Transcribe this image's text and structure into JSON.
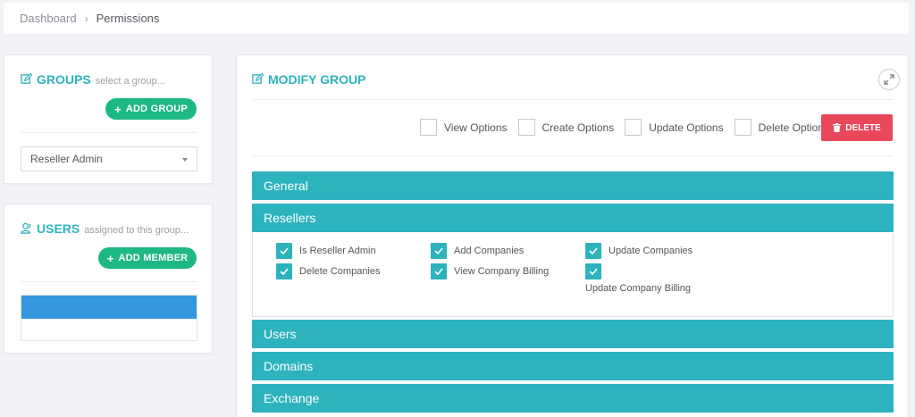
{
  "breadcrumb": {
    "home": "Dashboard",
    "separator": "›",
    "current": "Permissions"
  },
  "groups_panel": {
    "title": "GROUPS",
    "subtitle": "select a group...",
    "add_label": "ADD GROUP",
    "select_value": "Reseller Admin"
  },
  "users_panel": {
    "title": "USERS",
    "subtitle": "assigned to this group...",
    "add_label": "ADD MEMBER"
  },
  "modify_panel": {
    "title": "MODIFY GROUP",
    "options": [
      "View Options",
      "Create Options",
      "Update Options",
      "Delete Options"
    ],
    "delete_label": "DELETE",
    "sections": [
      "General",
      "Resellers",
      "Users",
      "Domains",
      "Exchange"
    ],
    "reseller_permissions": [
      "Is Reseller Admin",
      "Add Companies",
      "Update Companies",
      "Delete Companies",
      "View Company Billing",
      "Update Company Billing"
    ]
  },
  "colors": {
    "accent": "#2cb3bd",
    "green": "#1db886",
    "danger": "#e9475a",
    "selected_row": "#3597de"
  },
  "icons": {
    "title": "edit-icon",
    "users_title": "users-icon",
    "expand": "expand-icon",
    "delete": "trash-icon",
    "check": "check-icon"
  }
}
